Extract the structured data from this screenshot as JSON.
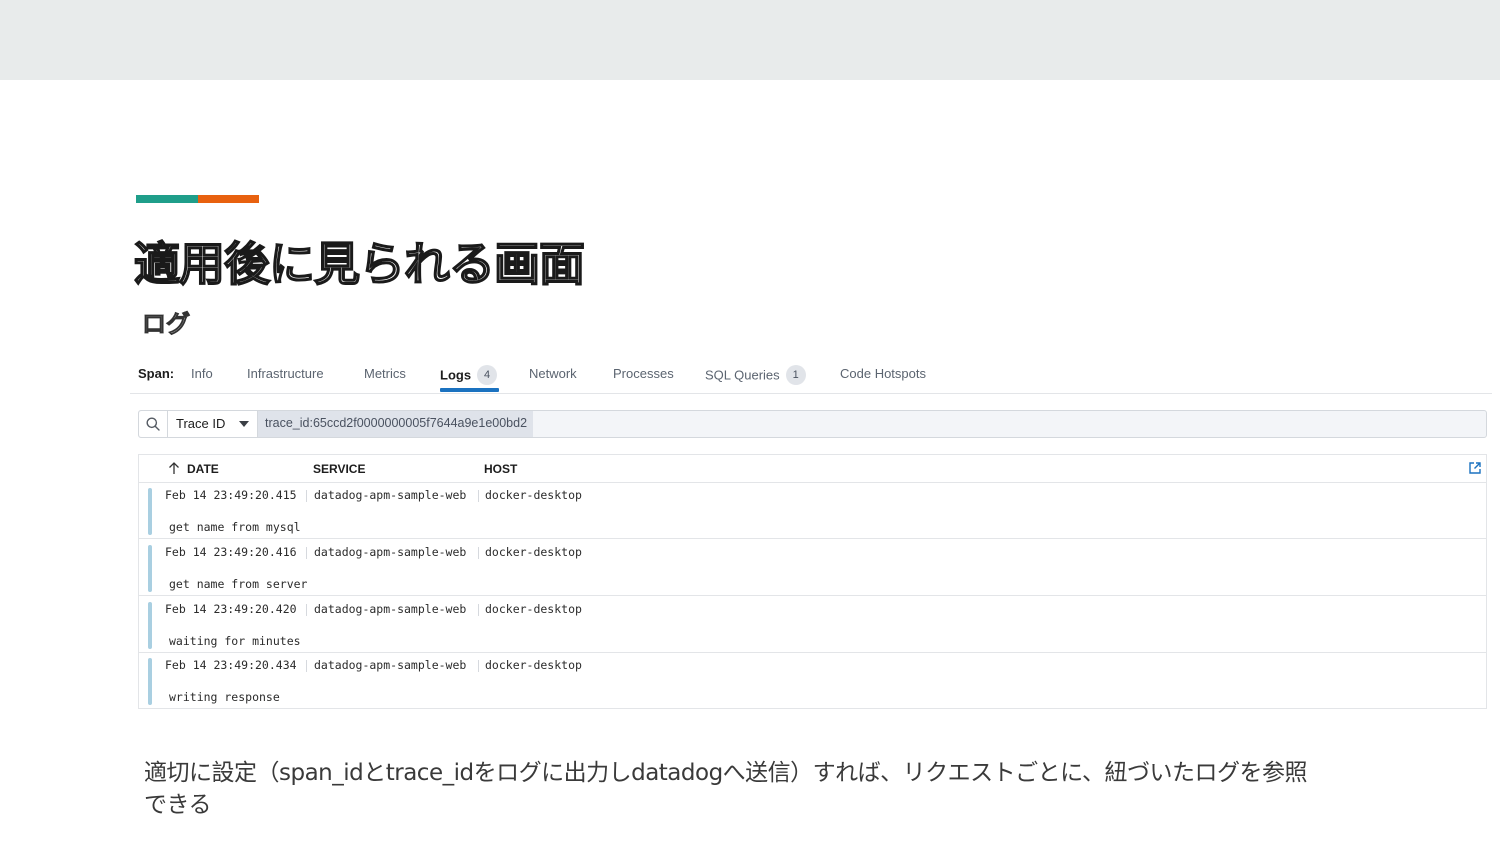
{
  "colors": {
    "accent_teal": "#1f9e8a",
    "accent_orange": "#e8610f",
    "tab_active": "#1b72c0",
    "log_bar": "#a9cfe1"
  },
  "slide": {
    "title": "適用後に見られる画面",
    "subtitle": "ログ",
    "caption": "適切に設定（span_idとtrace_idをログに出力しdatadogへ送信）すれば、リクエストごとに、紐づいたログを参照できる"
  },
  "panel": {
    "span_label": "Span:",
    "tabs": [
      {
        "label": "Info"
      },
      {
        "label": "Infrastructure"
      },
      {
        "label": "Metrics"
      },
      {
        "label": "Logs",
        "badge": "4",
        "active": true
      },
      {
        "label": "Network"
      },
      {
        "label": "Processes"
      },
      {
        "label": "SQL Queries",
        "badge": "1"
      },
      {
        "label": "Code Hotspots"
      }
    ],
    "search": {
      "icon": "search-icon",
      "facet": "Trace ID",
      "query": "trace_id:65ccd2f0000000005f7644a9e1e00bd2"
    },
    "columns": {
      "date": "DATE",
      "service": "SERVICE",
      "host": "HOST"
    },
    "rows": [
      {
        "date": "Feb 14 23:49:20.415",
        "service": "datadog-apm-sample-web",
        "host": "docker-desktop",
        "message": "get name from mysql"
      },
      {
        "date": "Feb 14 23:49:20.416",
        "service": "datadog-apm-sample-web",
        "host": "docker-desktop",
        "message": "get name from server"
      },
      {
        "date": "Feb 14 23:49:20.420",
        "service": "datadog-apm-sample-web",
        "host": "docker-desktop",
        "message": "waiting for minutes"
      },
      {
        "date": "Feb 14 23:49:20.434",
        "service": "datadog-apm-sample-web",
        "host": "docker-desktop",
        "message": "writing response"
      }
    ]
  }
}
